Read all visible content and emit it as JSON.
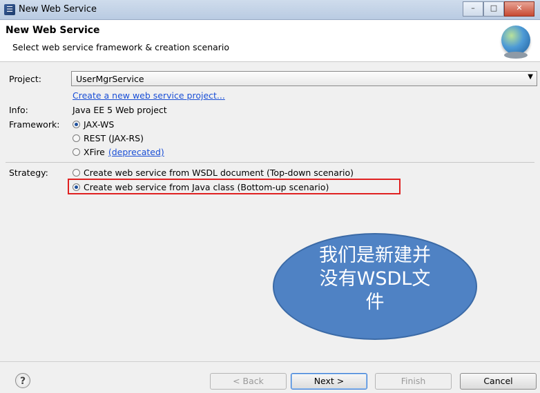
{
  "window": {
    "title": "New Web Service",
    "icon": "eclipse-icon",
    "controls": {
      "minimize": "–",
      "maximize": "□",
      "close": "✕"
    }
  },
  "banner": {
    "title": "New Web Service",
    "subtitle": "Select web service framework & creation scenario",
    "icon": "globe-icon"
  },
  "form": {
    "project_label": "Project:",
    "project_value": "UserMgrService",
    "create_project_link": "Create a new web service project...",
    "info_label": "Info:",
    "info_value": "Java EE 5 Web project",
    "framework_label": "Framework:",
    "framework_options": [
      {
        "label": "JAX-WS",
        "checked": true
      },
      {
        "label": "REST (JAX-RS)",
        "checked": false
      },
      {
        "label": "XFire",
        "checked": false,
        "link": "(deprecated)"
      }
    ],
    "strategy_label": "Strategy:",
    "strategy_options": [
      {
        "label": "Create web service from WSDL document (Top-down scenario)",
        "checked": false
      },
      {
        "label": "Create web service from Java class (Bottom-up scenario)",
        "checked": true
      }
    ]
  },
  "annotation": {
    "lines": [
      "我们是新建并",
      "没有WSDL文",
      "件"
    ]
  },
  "buttons": {
    "help": "?",
    "back": "< Back",
    "next": "Next >",
    "finish": "Finish",
    "cancel": "Cancel"
  }
}
